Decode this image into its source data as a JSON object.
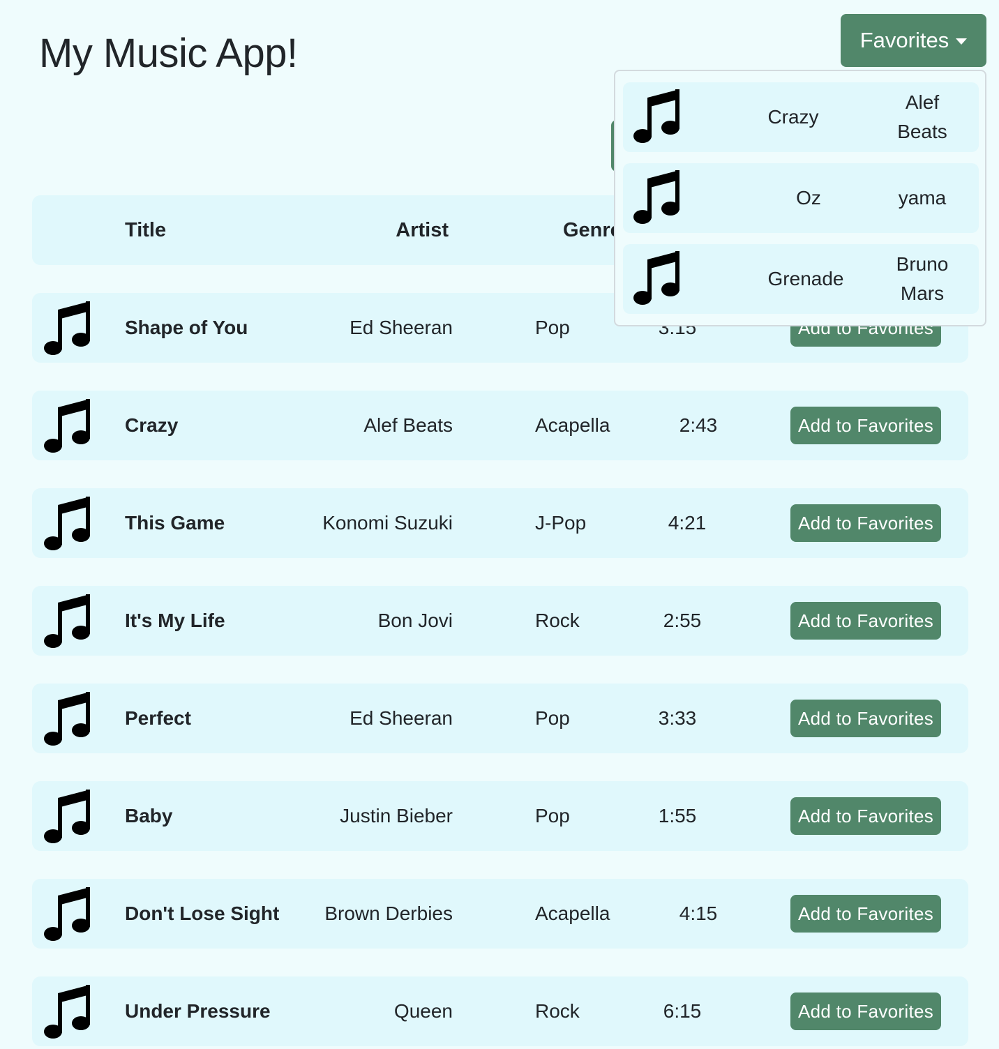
{
  "app": {
    "title": "My Music App!"
  },
  "favorites_toggle": {
    "label": "Favorites"
  },
  "table": {
    "headers": {
      "title": "Title",
      "artist": "Artist",
      "genre": "Genre"
    }
  },
  "songs": [
    {
      "title": "Shape of You",
      "artist": "Ed Sheeran",
      "genre": "Pop",
      "duration": "3:15",
      "action": "Add to Favorites"
    },
    {
      "title": "Crazy",
      "artist": "Alef Beats",
      "genre": "Acapella",
      "duration": "2:43",
      "action": "Add to Favorites"
    },
    {
      "title": "This Game",
      "artist": "Konomi Suzuki",
      "genre": "J-Pop",
      "duration": "4:21",
      "action": "Add to Favorites"
    },
    {
      "title": "It's My Life",
      "artist": "Bon Jovi",
      "genre": "Rock",
      "duration": "2:55",
      "action": "Add to Favorites"
    },
    {
      "title": "Perfect",
      "artist": "Ed Sheeran",
      "genre": "Pop",
      "duration": "3:33",
      "action": "Add to Favorites"
    },
    {
      "title": "Baby",
      "artist": "Justin Bieber",
      "genre": "Pop",
      "duration": "1:55",
      "action": "Add to Favorites"
    },
    {
      "title": "Don't Lose Sight",
      "artist": "Brown Derbies",
      "genre": "Acapella",
      "duration": "4:15",
      "action": "Add to Favorites"
    },
    {
      "title": "Under Pressure",
      "artist": "Queen",
      "genre": "Rock",
      "duration": "6:15",
      "action": "Add to Favorites"
    }
  ],
  "favorites_menu": {
    "items": [
      {
        "title": "Crazy",
        "artist": "Alef Beats"
      },
      {
        "title": "Oz",
        "artist": "yama"
      },
      {
        "title": "Grenade",
        "artist": "Bruno Mars"
      }
    ]
  },
  "icons": {
    "song": "music-note-icon",
    "dropdown": "caret-down-icon"
  },
  "colors": {
    "background": "#effcfd",
    "row_background": "#e0f8fc",
    "button": "#51876a",
    "button_text": "#ffffff",
    "text": "#212529"
  }
}
